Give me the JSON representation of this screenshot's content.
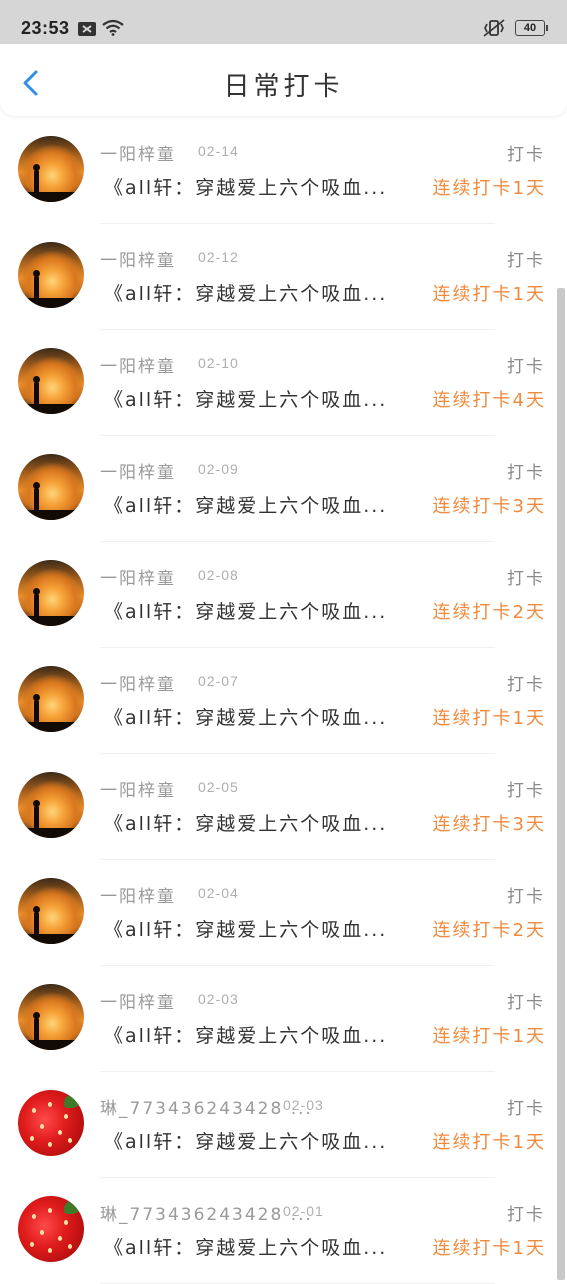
{
  "status_bar": {
    "time": "23:53",
    "battery": "40"
  },
  "header": {
    "title": "日常打卡"
  },
  "colors": {
    "streak": "#f08a3e",
    "status_bar_bg": "#d6d6d6",
    "back_arrow": "#2f8ee6"
  },
  "rows": [
    {
      "user": "一阳梓童",
      "date": "02-14",
      "action": "打卡",
      "book": "《all轩：穿越爱上六个吸血...",
      "streak": "连续打卡1天",
      "avatar": "sunset"
    },
    {
      "user": "一阳梓童",
      "date": "02-12",
      "action": "打卡",
      "book": "《all轩：穿越爱上六个吸血...",
      "streak": "连续打卡1天",
      "avatar": "sunset"
    },
    {
      "user": "一阳梓童",
      "date": "02-10",
      "action": "打卡",
      "book": "《all轩：穿越爱上六个吸血...",
      "streak": "连续打卡4天",
      "avatar": "sunset"
    },
    {
      "user": "一阳梓童",
      "date": "02-09",
      "action": "打卡",
      "book": "《all轩：穿越爱上六个吸血...",
      "streak": "连续打卡3天",
      "avatar": "sunset"
    },
    {
      "user": "一阳梓童",
      "date": "02-08",
      "action": "打卡",
      "book": "《all轩：穿越爱上六个吸血...",
      "streak": "连续打卡2天",
      "avatar": "sunset"
    },
    {
      "user": "一阳梓童",
      "date": "02-07",
      "action": "打卡",
      "book": "《all轩：穿越爱上六个吸血...",
      "streak": "连续打卡1天",
      "avatar": "sunset"
    },
    {
      "user": "一阳梓童",
      "date": "02-05",
      "action": "打卡",
      "book": "《all轩：穿越爱上六个吸血...",
      "streak": "连续打卡3天",
      "avatar": "sunset"
    },
    {
      "user": "一阳梓童",
      "date": "02-04",
      "action": "打卡",
      "book": "《all轩：穿越爱上六个吸血...",
      "streak": "连续打卡2天",
      "avatar": "sunset"
    },
    {
      "user": "一阳梓童",
      "date": "02-03",
      "action": "打卡",
      "book": "《all轩：穿越爱上六个吸血...",
      "streak": "连续打卡1天",
      "avatar": "sunset"
    },
    {
      "user": "琳_773436243428 ...",
      "date": "02-03",
      "action": "打卡",
      "book": "《all轩：穿越爱上六个吸血...",
      "streak": "连续打卡1天",
      "avatar": "strawberry"
    },
    {
      "user": "琳_773436243428 ...",
      "date": "02-01",
      "action": "打卡",
      "book": "《all轩：穿越爱上六个吸血...",
      "streak": "连续打卡1天",
      "avatar": "strawberry"
    }
  ]
}
